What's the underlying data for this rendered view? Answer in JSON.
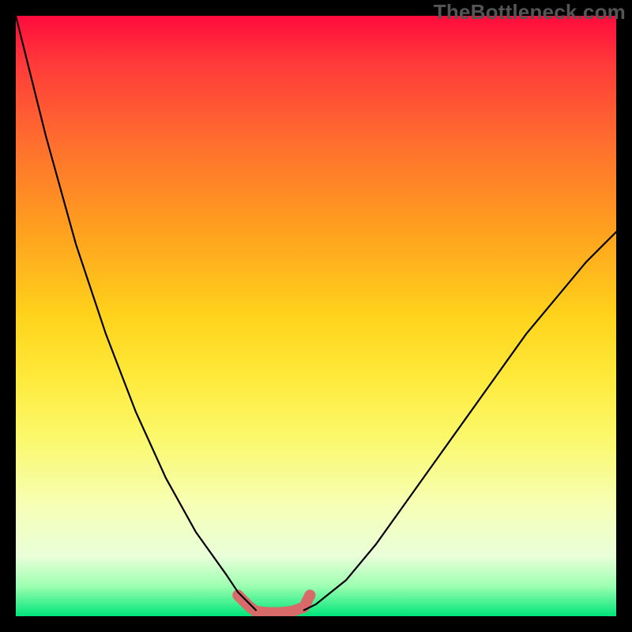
{
  "watermark": "TheBottleneck.com",
  "chart_data": {
    "type": "line",
    "title": "",
    "xlabel": "",
    "ylabel": "",
    "xlim": [
      0,
      100
    ],
    "ylim": [
      0,
      100
    ],
    "annotations": [],
    "background": {
      "gradient": "vertical",
      "stops": [
        {
          "pos": 0,
          "color": "#ff0b3c"
        },
        {
          "pos": 50,
          "color": "#ffd31b"
        },
        {
          "pos": 82,
          "color": "#f6ffb8"
        },
        {
          "pos": 100,
          "color": "#00e57a"
        }
      ]
    },
    "series": [
      {
        "name": "left-curve",
        "color": "#000000",
        "x": [
          0,
          5,
          10,
          15,
          20,
          25,
          30,
          35,
          37,
          39,
          40
        ],
        "y": [
          100,
          80,
          62,
          47,
          34,
          23,
          14,
          7,
          4,
          2,
          1
        ]
      },
      {
        "name": "right-curve",
        "color": "#000000",
        "x": [
          48,
          50,
          55,
          60,
          65,
          70,
          75,
          80,
          85,
          90,
          95,
          100
        ],
        "y": [
          1,
          2,
          6,
          12,
          19,
          26,
          33,
          40,
          47,
          53,
          59,
          64
        ]
      },
      {
        "name": "valley-floor",
        "color": "#d96a6a",
        "stroke_width_px": 14,
        "x": [
          37,
          39,
          40,
          42,
          44,
          46,
          48,
          49
        ],
        "y": [
          3.5,
          1.5,
          0.8,
          0.6,
          0.6,
          0.8,
          1.5,
          3.5
        ]
      }
    ]
  }
}
